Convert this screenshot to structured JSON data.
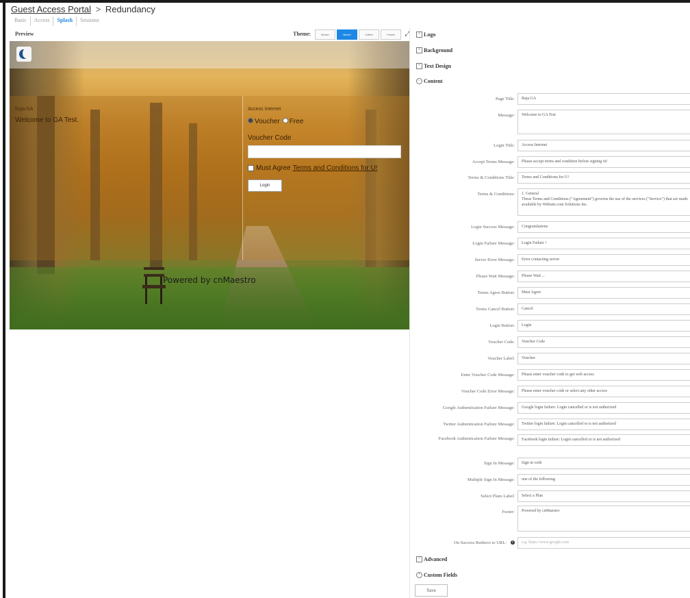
{
  "breadcrumb": {
    "root": "Guest Access Portal",
    "separator": ">",
    "current": "Redundancy"
  },
  "tabs": [
    {
      "label": "Basic",
      "active": false
    },
    {
      "label": "Access",
      "active": false
    },
    {
      "label": "Splash",
      "active": true
    },
    {
      "label": "Sessions",
      "active": false
    }
  ],
  "preview_bar": {
    "label": "Preview",
    "theme_label": "Theme:",
    "themes": [
      {
        "label": "Brown",
        "active": false
      },
      {
        "label": "Beach",
        "active": true
      },
      {
        "label": "Coffee",
        "active": false
      },
      {
        "label": "Forest",
        "active": false
      }
    ],
    "expand_glyph": "⤢"
  },
  "preview": {
    "page_title": "Raja GA",
    "message": "Welcome to GA Test.",
    "login_title": "Access Internet",
    "radio_voucher": "Voucher",
    "radio_free": "Free",
    "voucher_code_label": "Voucher Code",
    "agree_prefix": "Must Agree",
    "agree_link": "Terms and Conditions for U!",
    "login_button": "Login",
    "footer": "Powered by cnMaestro"
  },
  "sections": {
    "logo": "Logo",
    "background": "Background",
    "text_design": "Text Design",
    "content": "Content",
    "advanced": "Advanced",
    "custom_fields": "Custom Fields"
  },
  "form": {
    "page_title": {
      "label": "Page Title:",
      "value": "Raja GA"
    },
    "message": {
      "label": "Message:",
      "value": "Welcome to GA Test"
    },
    "login_title": {
      "label": "Login Title:",
      "value": "Access Internet"
    },
    "accept_terms_message": {
      "label": "Accept Terms Message:",
      "value": "Please accept terms and condition before signing in!"
    },
    "terms_title": {
      "label": "Terms & Conditions Title:",
      "value": "Terms and Conditions for U!"
    },
    "terms": {
      "label": "Terms & Conditions:",
      "value": "1. General\nThese Terms and Conditions (\"Agreement\") governs the use of the services (\"Service\") that are made available by Website.com Solutions Inc."
    },
    "login_success": {
      "label": "Login Success Message:",
      "value": "Congratulations"
    },
    "login_failure": {
      "label": "Login Failure Message:",
      "value": "Login Failure !"
    },
    "server_error": {
      "label": "Server Error Message:",
      "value": "Error contacting server"
    },
    "please_wait": {
      "label": "Please Wait Message:",
      "value": "Please Wait ..."
    },
    "terms_agree_button": {
      "label": "Terms Agree Button:",
      "value": "Must Agree"
    },
    "terms_cancel_button": {
      "label": "Terms Cancel Button:",
      "value": "Cancel"
    },
    "login_button": {
      "label": "Login Button:",
      "value": "Login"
    },
    "voucher_code": {
      "label": "Voucher Code:",
      "value": "Voucher Code"
    },
    "voucher_label": {
      "label": "Voucher Label:",
      "value": "Voucher"
    },
    "enter_voucher_msg": {
      "label": "Enter Voucher Code Message:",
      "value": "Please enter voucher code to get web access"
    },
    "voucher_error_msg": {
      "label": "Voucher Code Error Message:",
      "value": "Please enter voucher code or select any other access"
    },
    "google_auth_fail": {
      "label": "Google Authentication Failure Message:",
      "value": "Google login failure: Login cancelled or is not authorized"
    },
    "twitter_auth_fail": {
      "label": "Twitter Authentication Failure Message:",
      "value": "Twitter login failure: Login cancelled or is not authorized"
    },
    "facebook_auth_fail": {
      "label": "Facebook Authentication Failure Message:",
      "value": "Facebook login failure: Login cancelled or is not authorized"
    },
    "sign_in_message": {
      "label": "Sign In Message:",
      "value": "Sign in with"
    },
    "multiple_sign_in": {
      "label": "Multiple Sign In Message:",
      "value": "one of the following"
    },
    "select_plans": {
      "label": "Select Plans Label:",
      "value": "Select a Plan"
    },
    "footer": {
      "label": "Footer:",
      "value": "Powered by cnMaestro"
    },
    "redirect_url": {
      "label": "On Success Redirect to URL:",
      "placeholder": "e.g. https://www.google.com"
    }
  },
  "save_button": "Save",
  "icons": {
    "expand": "expand-icon",
    "plus": "plus-box-icon",
    "minus": "minus-box-icon",
    "info": "info-icon",
    "logo": "cambium-logo-icon"
  }
}
